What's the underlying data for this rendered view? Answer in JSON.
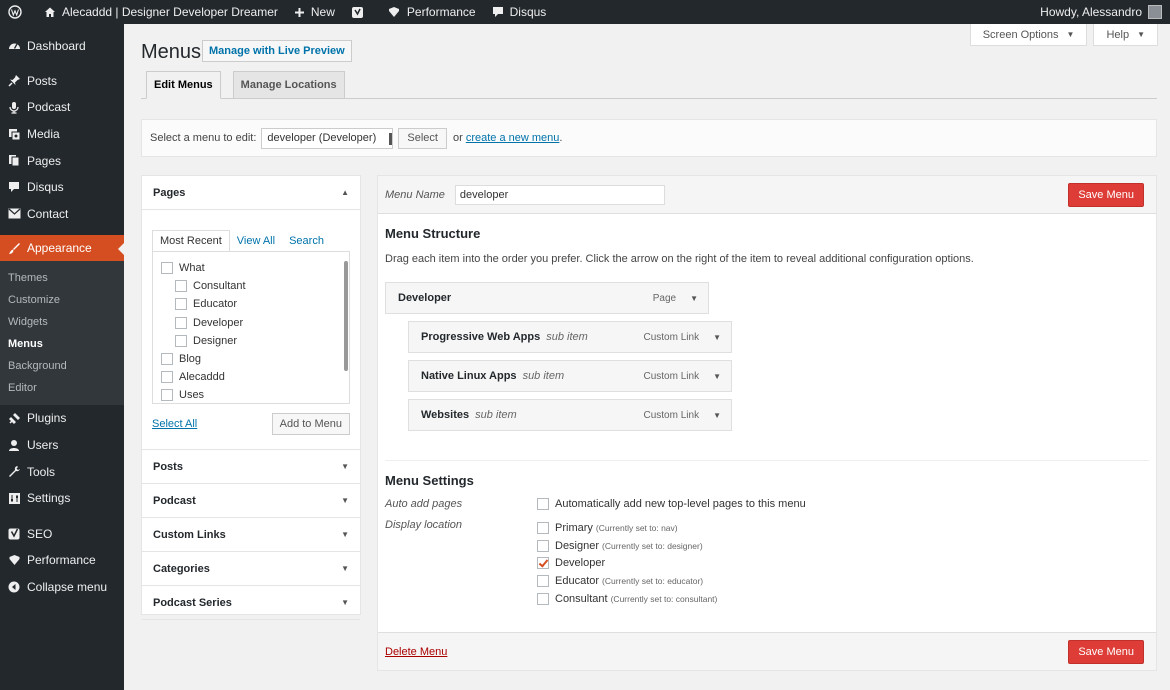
{
  "admin_bar": {
    "site_name": "Alecaddd | Designer Developer Dreamer",
    "new_label": "New",
    "performance_label": "Performance",
    "disqus_label": "Disqus",
    "howdy": "Howdy, Alessandro"
  },
  "sidebar": {
    "items": [
      {
        "label": "Dashboard",
        "icon": "dashboard-icon"
      },
      {
        "label": "Posts",
        "icon": "pin-icon"
      },
      {
        "label": "Podcast",
        "icon": "microphone-icon"
      },
      {
        "label": "Media",
        "icon": "media-icon"
      },
      {
        "label": "Pages",
        "icon": "pages-icon"
      },
      {
        "label": "Disqus",
        "icon": "comment-icon"
      },
      {
        "label": "Contact",
        "icon": "mail-icon"
      },
      {
        "label": "Appearance",
        "icon": "brush-icon"
      }
    ],
    "appearance_submenu": [
      "Themes",
      "Customize",
      "Widgets",
      "Menus",
      "Background",
      "Editor"
    ],
    "items_after": [
      {
        "label": "Plugins",
        "icon": "plug-icon"
      },
      {
        "label": "Users",
        "icon": "user-icon"
      },
      {
        "label": "Tools",
        "icon": "wrench-icon"
      },
      {
        "label": "Settings",
        "icon": "settings-icon"
      },
      {
        "label": "SEO",
        "icon": "yoast-icon"
      },
      {
        "label": "Performance",
        "icon": "performance-icon"
      },
      {
        "label": "Collapse menu",
        "icon": "collapse-icon"
      }
    ]
  },
  "screen_options_label": "Screen Options",
  "help_label": "Help",
  "page": {
    "title": "Menus",
    "live_preview_label": "Manage with Live Preview",
    "tabs": [
      "Edit Menus",
      "Manage Locations"
    ]
  },
  "select_menu": {
    "prompt": "Select a menu to edit:",
    "selected": "developer (Developer)",
    "select_label": "Select",
    "or_text": "or",
    "create_link": "create a new menu",
    "period": "."
  },
  "accordion": {
    "pages_title": "Pages",
    "tabs": [
      "Most Recent",
      "View All",
      "Search"
    ],
    "pages": [
      {
        "label": "What",
        "indent": false
      },
      {
        "label": "Consultant",
        "indent": true
      },
      {
        "label": "Educator",
        "indent": true
      },
      {
        "label": "Developer",
        "indent": true
      },
      {
        "label": "Designer",
        "indent": true
      },
      {
        "label": "Blog",
        "indent": false
      },
      {
        "label": "Alecaddd",
        "indent": false
      },
      {
        "label": "Uses",
        "indent": false
      }
    ],
    "select_all": "Select All",
    "add_to_menu": "Add to Menu",
    "sections": [
      "Posts",
      "Podcast",
      "Custom Links",
      "Categories",
      "Podcast Series"
    ]
  },
  "menu_edit": {
    "name_label": "Menu Name",
    "name_value": "developer",
    "save_label": "Save Menu",
    "structure_title": "Menu Structure",
    "instructions": "Drag each item into the order you prefer. Click the arrow on the right of the item to reveal additional configuration options.",
    "items": [
      {
        "title": "Developer",
        "sub": "",
        "type": "Page"
      },
      {
        "title": "Progressive Web Apps",
        "sub": "sub item",
        "type": "Custom Link"
      },
      {
        "title": "Native Linux Apps",
        "sub": "sub item",
        "type": "Custom Link"
      },
      {
        "title": "Websites",
        "sub": "sub item",
        "type": "Custom Link"
      }
    ],
    "settings_title": "Menu Settings",
    "auto_add_label": "Auto add pages",
    "auto_add_text": "Automatically add new top-level pages to this menu",
    "display_location_label": "Display location",
    "locations": [
      {
        "name": "Primary",
        "note": "(Currently set to: nav)",
        "checked": false
      },
      {
        "name": "Designer",
        "note": "(Currently set to: designer)",
        "checked": false
      },
      {
        "name": "Developer",
        "note": "",
        "checked": true
      },
      {
        "name": "Educator",
        "note": "(Currently set to: educator)",
        "checked": false
      },
      {
        "name": "Consultant",
        "note": "(Currently set to: consultant)",
        "checked": false
      }
    ],
    "delete_label": "Delete Menu"
  },
  "colors": {
    "accent": "#d54e21",
    "save": "#dd3d36",
    "link": "#0073aa",
    "sidebar_bg": "#23282d"
  }
}
